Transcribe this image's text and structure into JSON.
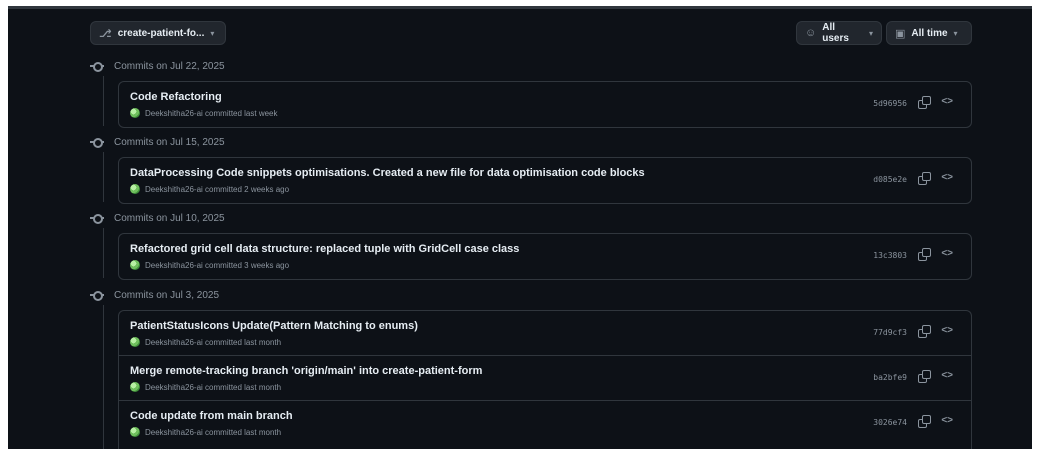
{
  "toolbar": {
    "branch_label": "create-patient-fo...",
    "users_label": "All users",
    "time_label": "All time"
  },
  "groups": [
    {
      "heading": "Commits on Jul 22, 2025",
      "commits": [
        {
          "message": "Code Refactoring",
          "meta": "Deekshitha26-ai committed last week",
          "sha": "5d96956"
        }
      ]
    },
    {
      "heading": "Commits on Jul 15, 2025",
      "commits": [
        {
          "message": "DataProcessing Code snippets optimisations. Created a new file for data optimisation code blocks",
          "meta": "Deekshitha26-ai committed 2 weeks ago",
          "sha": "d085e2e"
        }
      ]
    },
    {
      "heading": "Commits on Jul 10, 2025",
      "commits": [
        {
          "message": "Refactored grid cell data structure: replaced tuple with GridCell case class",
          "meta": "Deekshitha26-ai committed 3 weeks ago",
          "sha": "13c3803"
        }
      ]
    },
    {
      "heading": "Commits on Jul 3, 2025",
      "commits": [
        {
          "message": "PatientStatusIcons Update(Pattern Matching to enums)",
          "meta": "Deekshitha26-ai committed last month",
          "sha": "77d9cf3"
        },
        {
          "message": "Merge remote-tracking branch 'origin/main' into create-patient-form",
          "meta": "Deekshitha26-ai committed last month",
          "sha": "ba2bfe9"
        },
        {
          "message": "Code update from main branch",
          "meta": "Deekshitha26-ai committed last month",
          "sha": "3026e74"
        }
      ]
    }
  ]
}
